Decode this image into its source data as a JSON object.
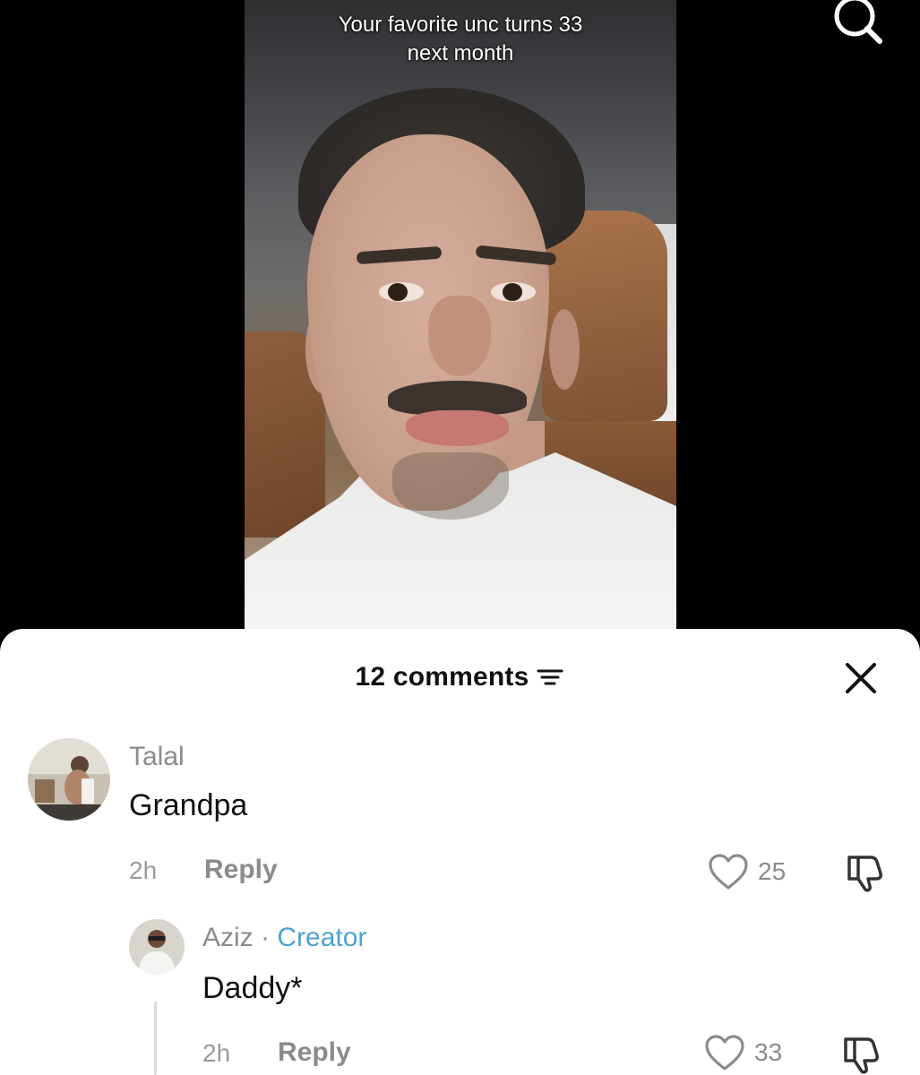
{
  "video": {
    "caption": "Your favorite unc turns 33\nnext month"
  },
  "comments_panel": {
    "count_label": "12 comments",
    "comments": [
      {
        "username": "Talal",
        "text": "Grandpa",
        "time": "2h",
        "reply_label": "Reply",
        "likes": "25"
      },
      {
        "username": "Aziz",
        "separator": " · ",
        "badge": "Creator",
        "text": "Daddy*",
        "time": "2h",
        "reply_label": "Reply",
        "likes": "33"
      }
    ]
  },
  "colors": {
    "creator_badge": "#4ba3cf",
    "sheet_background": "#ffffff",
    "video_background": "#000000"
  },
  "icons": [
    "search-icon",
    "sort-icon",
    "close-icon",
    "heart-icon",
    "dislike-icon"
  ]
}
